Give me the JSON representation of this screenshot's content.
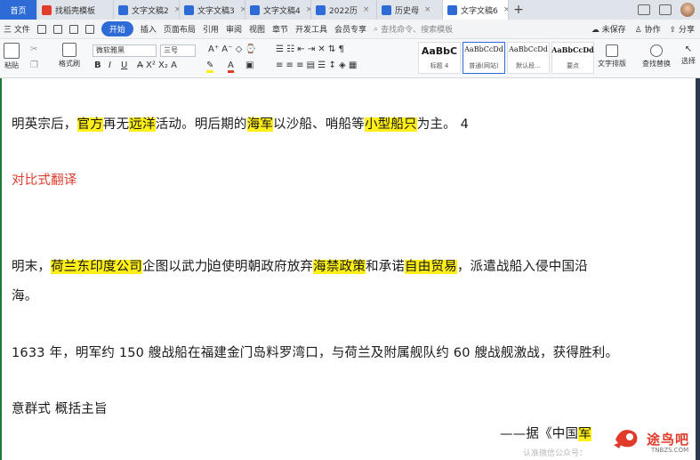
{
  "tabs": [
    {
      "label": "首页",
      "kind": "home"
    },
    {
      "label": "找稻壳模板",
      "kind": "red"
    },
    {
      "label": "文字文稿2",
      "close": "×"
    },
    {
      "label": "文字文稿3",
      "close": "×"
    },
    {
      "label": "文字文稿4",
      "close": "×"
    },
    {
      "label": "2022历",
      "close": "×"
    },
    {
      "label": "历史母",
      "close": "×"
    },
    {
      "label": "文字文稿6",
      "close": "×",
      "active": true
    }
  ],
  "new_tab": "+",
  "menu": {
    "file": "三 文件",
    "items": [
      "开始",
      "插入",
      "页面布局",
      "引用",
      "审阅",
      "视图",
      "章节",
      "开发工具",
      "会员专享"
    ],
    "search_placeholder": "查找命令、搜索模板",
    "unsaved": "未保存",
    "collab": "协作",
    "share": "分享"
  },
  "ribbon": {
    "paste": "粘贴",
    "format_painter": "格式刷",
    "font_name": "微软雅黑",
    "font_size": "三号",
    "styles": [
      {
        "preview": "AaBbC",
        "label": "标题 4"
      },
      {
        "preview": "AaBbCcDd",
        "label": "普通(网站)"
      },
      {
        "preview": "AaBbCcDd",
        "label": "默认段..."
      },
      {
        "preview": "AaBbCcDd",
        "label": "要点"
      }
    ],
    "text_layout": "文字排版",
    "find_replace": "查找替换",
    "select": "选择"
  },
  "document": {
    "line1": {
      "parts": [
        {
          "t": "明英宗后，"
        },
        {
          "t": "官方",
          "hl": true
        },
        {
          "t": "再无"
        },
        {
          "t": "远洋",
          "hl": true
        },
        {
          "t": "活动。明后期的"
        },
        {
          "t": "海军",
          "hl": true
        },
        {
          "t": "以沙船、哨船等"
        },
        {
          "t": "小型船只",
          "hl": true
        },
        {
          "t": "为主。  4"
        }
      ]
    },
    "heading_red": "对比式翻译",
    "line3": {
      "parts": [
        {
          "t": "明末，"
        },
        {
          "t": "荷兰东印度公司",
          "hl": true
        },
        {
          "t": "企图以武力"
        },
        {
          "t": "迫使明朝政府放弃"
        },
        {
          "t": "海禁政策",
          "hl": true
        },
        {
          "t": "和承诺"
        },
        {
          "t": "自由贸易",
          "hl": true
        },
        {
          "t": "，派遣战船入侵中国沿"
        }
      ]
    },
    "line3b": "海。",
    "line4": "1633 年，明军约 150 艘战船在福建金门岛料罗湾口，与荷兰及附属舰队约 60 艘战舰激战，获得胜利。",
    "line5": "意群式  概括主旨",
    "source": {
      "parts": [
        {
          "t": "——据《中国"
        },
        {
          "t": "军",
          "hl": true
        }
      ]
    }
  },
  "watermark": {
    "text": "认准微信公众号：",
    "site": "途鸟吧",
    "url": "TNBZS.COM"
  }
}
